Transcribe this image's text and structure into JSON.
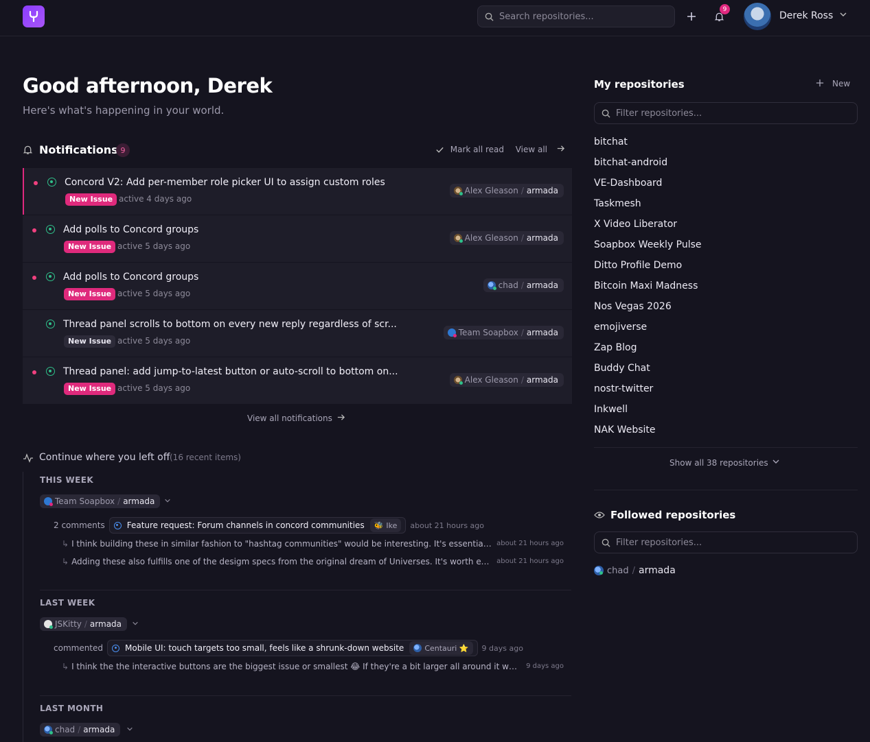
{
  "header": {
    "search_placeholder": "Search repositories...",
    "notif_count": "9",
    "user_name": "Derek Ross"
  },
  "greeting": {
    "title": "Good afternoon, Derek",
    "subtitle": "Here's what's happening in your world."
  },
  "notifications": {
    "title": "Notifications",
    "count": "9",
    "mark_all_read": "Mark all read",
    "view_all": "View all",
    "view_all_footer": "View all notifications",
    "items": [
      {
        "title": "Concord V2: Add per-member role picker UI to assign custom roles",
        "badge": "New Issue",
        "active": "active 4 days ago",
        "owner": "Alex Gleason",
        "repo": "armada",
        "unread": true
      },
      {
        "title": "Add polls to Concord groups",
        "badge": "New Issue",
        "active": "active 5 days ago",
        "owner": "Alex Gleason",
        "repo": "armada",
        "unread": true
      },
      {
        "title": "Add polls to Concord groups",
        "badge": "New Issue",
        "active": "active 5 days ago",
        "owner": "chad",
        "repo": "armada",
        "unread": true
      },
      {
        "title": "Thread panel scrolls to bottom on every new reply regardless of scr...",
        "badge": "New Issue",
        "active": "active 5 days ago",
        "owner": "Team Soapbox",
        "repo": "armada",
        "unread": false
      },
      {
        "title": "Thread panel: add jump-to-latest button or auto-scroll to bottom on...",
        "badge": "New Issue",
        "active": "active 5 days ago",
        "owner": "Alex Gleason",
        "repo": "armada",
        "unread": true
      }
    ]
  },
  "continue": {
    "title": "Continue where you left off",
    "count": "(16 recent items)",
    "this_week": {
      "label": "THIS WEEK",
      "owner": "Team Soapbox",
      "repo": "armada",
      "verb": "2 comments",
      "issue": "Feature request: Forum channels in concord communities",
      "author": "Ike",
      "time": "about 21 hours ago",
      "replies": [
        {
          "text": "I think building these in similar fashion to \"hashtag communities\" would be interesting. It's essentially a pri...",
          "time": "about 21 hours ago"
        },
        {
          "text": "Adding these also fulfills one of the desigm specs from the original dream of Universes. It's worth explorin...",
          "time": "about 21 hours ago"
        }
      ]
    },
    "last_week": {
      "label": "LAST WEEK",
      "owner": "JSKitty",
      "repo": "armada",
      "verb": "commented",
      "issue": "Mobile UI: touch targets too small, feels like a shrunk-down website",
      "author": "Centauri ⭐",
      "time": "9 days ago",
      "replies": [
        {
          "text": "I think the the interactive buttons are the biggest issue or smallest 😂 If they're a bit larger all around it would fee...",
          "time": "9 days ago"
        }
      ]
    },
    "last_month": {
      "label": "LAST MONTH",
      "owner": "chad",
      "repo": "armada"
    }
  },
  "sidebar": {
    "my_repos_title": "My repositories",
    "new_label": "New",
    "filter_placeholder": "Filter repositories...",
    "repos": [
      "bitchat",
      "bitchat-android",
      "VE-Dashboard",
      "Taskmesh",
      "X Video Liberator",
      "Soapbox Weekly Pulse",
      "Ditto Profile Demo",
      "Bitcoin Maxi Madness",
      "Nos Vegas 2026",
      "emojiverse",
      "Zap Blog",
      "Buddy Chat",
      "nostr-twitter",
      "Inkwell",
      "NAK Website"
    ],
    "show_all": "Show all 38 repositories",
    "followed_title": "Followed repositories",
    "followed_filter_placeholder": "Filter repositories...",
    "followed": [
      {
        "owner": "chad",
        "repo": "armada"
      }
    ]
  },
  "colors": {
    "accent": "#df2a7c",
    "brand": "#8b3dff",
    "open": "#2fc08a",
    "background": "#15141f"
  }
}
